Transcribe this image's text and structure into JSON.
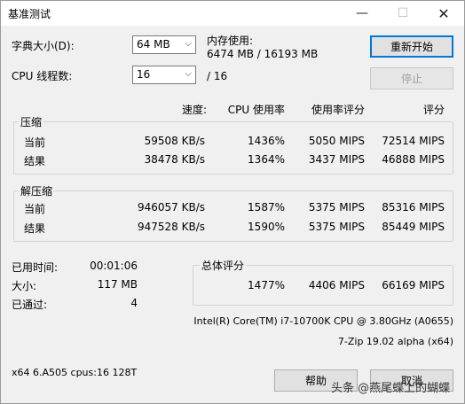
{
  "window": {
    "title": "基准测试",
    "min": "—",
    "max": "☐",
    "close": "✕"
  },
  "dict_label": "字典大小(D):",
  "dict_value": "64 MB",
  "thread_label": "CPU 线程数:",
  "thread_value": "16",
  "thread_total": "/ 16",
  "memory_label": "内存使用:",
  "memory_value": "6474 MB / 16193 MB",
  "restart_button": "重新开始",
  "stop_button": "停止",
  "headers": {
    "speed": "速度:",
    "cpu": "CPU 使用率",
    "rating_per_use": "使用率评分",
    "rating": "评分"
  },
  "compress": {
    "title": "压缩",
    "current": {
      "label": "当前",
      "speed": "59508 KB/s",
      "cpu": "1436%",
      "rpu": "5050 MIPS",
      "rating": "72514 MIPS"
    },
    "result": {
      "label": "结果",
      "speed": "38478 KB/s",
      "cpu": "1364%",
      "rpu": "3437 MIPS",
      "rating": "46888 MIPS"
    }
  },
  "decompress": {
    "title": "解压缩",
    "current": {
      "label": "当前",
      "speed": "946057 KB/s",
      "cpu": "1587%",
      "rpu": "5375 MIPS",
      "rating": "85316 MIPS"
    },
    "result": {
      "label": "结果",
      "speed": "947528 KB/s",
      "cpu": "1590%",
      "rpu": "5375 MIPS",
      "rating": "85449 MIPS"
    }
  },
  "elapsed_label": "已用时间:",
  "elapsed_value": "00:01:06",
  "size_label": "大小:",
  "size_value": "117 MB",
  "passes_label": "已通过:",
  "passes_value": "4",
  "total": {
    "title": "总体评分",
    "cpu": "1477%",
    "rpu": "4406 MIPS",
    "rating": "66169 MIPS"
  },
  "cpu_info": "Intel(R) Core(TM) i7-10700K CPU @ 3.80GHz (A0655)",
  "version": "7-Zip 19.02 alpha (x64)",
  "sys_info": "x64 6.A505 cpus:16 128T",
  "help_button": "帮助",
  "cancel_button": "取消",
  "watermark": "头条 @燕尾蝶上的蝴蝶"
}
